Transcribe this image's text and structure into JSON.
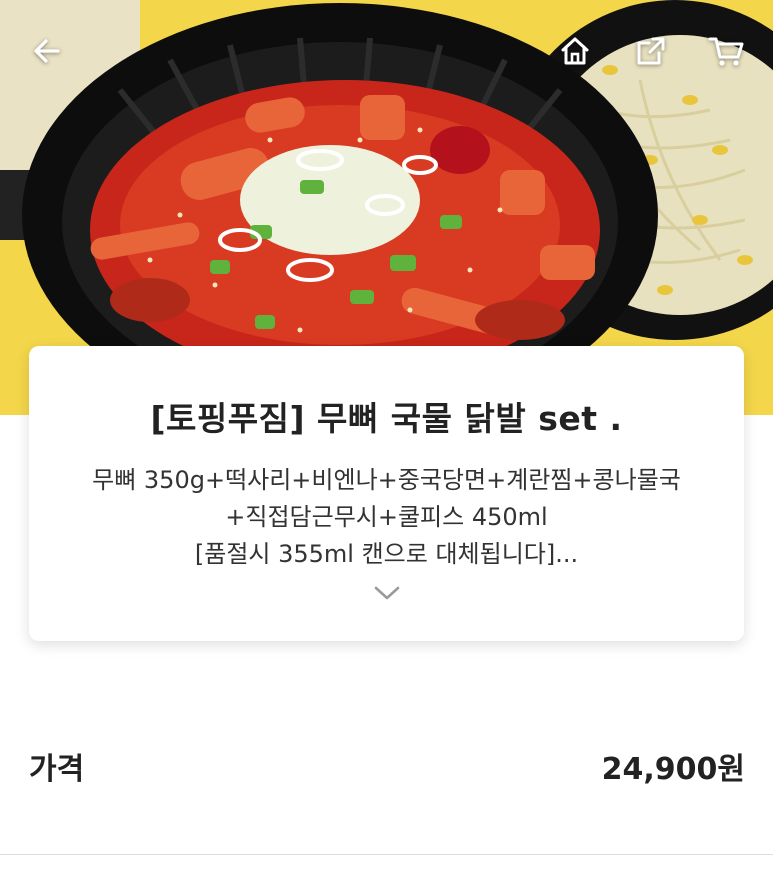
{
  "topbar": {
    "back_icon": "arrow-left-icon",
    "home_icon": "home-icon",
    "share_icon": "share-icon",
    "cart_icon": "cart-icon"
  },
  "product": {
    "title": "[토핑푸짐] 무뼈 국물 닭발 set .",
    "description_lines": [
      "무뼈 350g+떡사리+비엔나+중국당면+계란찜+콩나물국",
      "+직접담근무시+쿨피스 450ml",
      "[품절시 355ml 캔으로 대체됩니다]..."
    ],
    "expand_icon": "chevron-down-icon"
  },
  "price": {
    "label": "가격",
    "value": "24,900원"
  },
  "colors": {
    "background_accent": "#f4d84a",
    "card": "#ffffff",
    "text": "#222222"
  }
}
